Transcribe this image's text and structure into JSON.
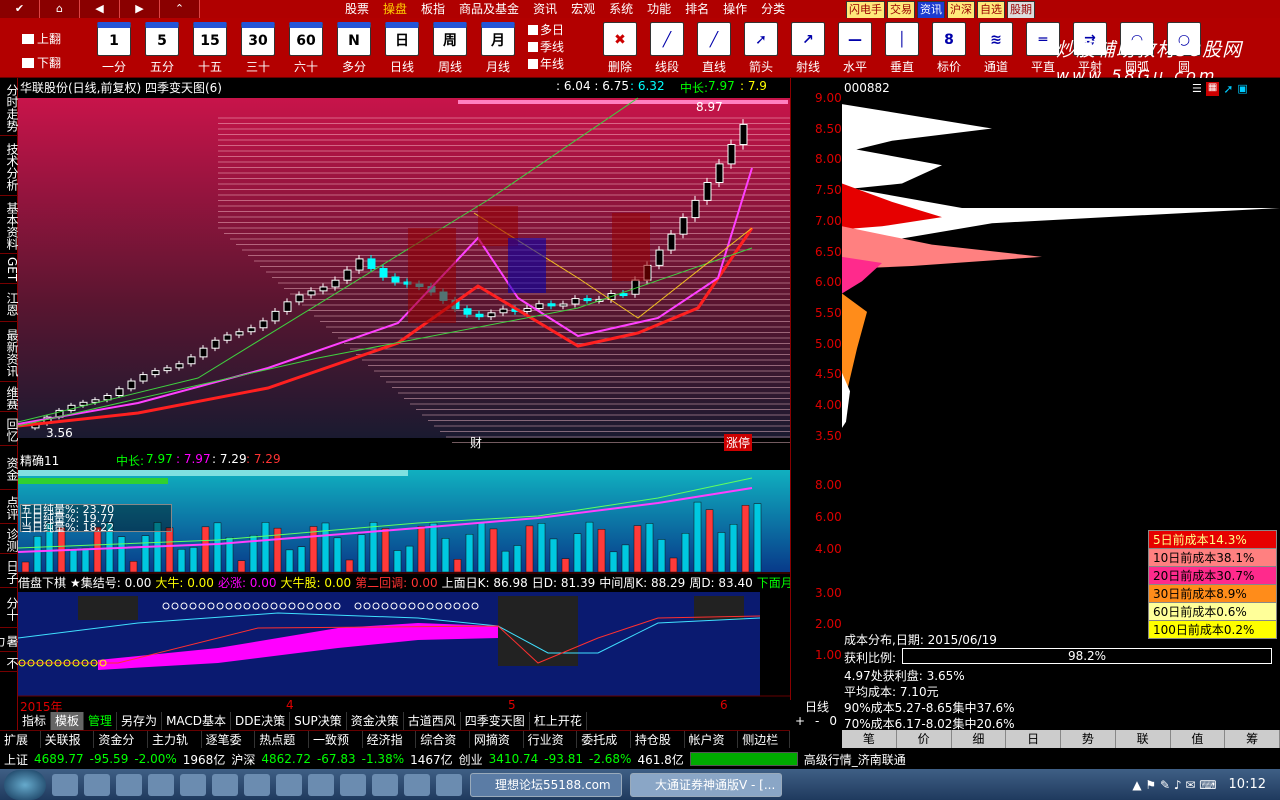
{
  "menubar": {
    "items": [
      "股票",
      "操盘",
      "板指",
      "商品及基金",
      "资讯",
      "宏观",
      "系统",
      "功能",
      "排名",
      "操作",
      "分类"
    ],
    "active_index": 1,
    "quick": [
      "闪电手",
      "交易",
      "资讯",
      "沪深",
      "自选",
      "股期"
    ]
  },
  "toolbar": {
    "up": "上翻",
    "down": "下翻",
    "periods": [
      {
        "icon": "1",
        "label": "一分"
      },
      {
        "icon": "5",
        "label": "五分"
      },
      {
        "icon": "15",
        "label": "十五"
      },
      {
        "icon": "30",
        "label": "三十"
      },
      {
        "icon": "60",
        "label": "六十"
      },
      {
        "icon": "N",
        "label": "多分"
      },
      {
        "icon": "日",
        "label": "日线"
      },
      {
        "icon": "周",
        "label": "周线"
      },
      {
        "icon": "月",
        "label": "月线"
      }
    ],
    "multi": [
      "多日",
      "季线",
      "年线"
    ],
    "tools": [
      "删除",
      "线段",
      "直线",
      "箭头",
      "射线",
      "水平",
      "垂直",
      "标价",
      "通道",
      "平直",
      "平射",
      "圆弧",
      "圆"
    ]
  },
  "watermark": {
    "line1": "炒股辅助教材58股网",
    "line2": "www.58Gu.com"
  },
  "lefttabs": [
    "分时走势",
    "技术分析",
    "基本资料",
    "GET",
    "江恩",
    "最新资讯",
    "维赛",
    "回忆",
    "资金",
    "点评",
    "诊测",
    "日子",
    "分十",
    "暑力",
    "不"
  ],
  "chart": {
    "title": "华联股份(日线,前复权) 四季变天图(6)",
    "range": ": 6.04 : 6.75",
    "val1": ": 6.32",
    "mid_label": "中长:",
    "mid_val": "7.97",
    "val2": ": 7.9",
    "price_axis": [
      "9.00",
      "8.50",
      "8.00",
      "7.50",
      "7.00",
      "6.50",
      "6.00",
      "5.50",
      "5.00",
      "4.50",
      "4.00",
      "3.50"
    ],
    "hi_label": "8.97",
    "lo_label": "3.56",
    "cai": "财",
    "zt": "涨停"
  },
  "ind1": {
    "name": "精确11",
    "mid_label": "中长:",
    "v1": "7.97",
    "v2": ": 7.97",
    "v3": ": 7.29",
    "v4": ": 7.29",
    "axis": [
      "8.00",
      "6.00",
      "4.00"
    ],
    "box": [
      "五日纯量%: 23.70",
      "十日纯量%: 19.77",
      "当日纯量%: 18.22"
    ]
  },
  "ind2": {
    "head": [
      "借盘下棋",
      "★集结号: 0.00",
      "大牛: 0.00",
      "必涨: 0.00",
      "大牛股: 0.00",
      "第二回调: 0.00",
      "上面日K: 86.98",
      "日D: 81.39",
      "中间周K: 88.29",
      "周D: 83.40",
      "下面月K"
    ],
    "axis": [
      "3.00",
      "2.00",
      "1.00"
    ]
  },
  "dateaxis": {
    "labels": [
      "2015年",
      "4",
      "5",
      "6"
    ],
    "right": "日线"
  },
  "info": {
    "code": "000882",
    "dist_date": "成本分布,日期: 2015/06/19",
    "profit_label": "获利比例:",
    "profit_val": "98.2%",
    "line1": "4.97处获利盘: 3.65%",
    "line2": "平均成本: 7.10元",
    "line3": "90%成本5.27-8.65集中37.6%",
    "line4": "70%成本6.17-8.02集中20.6%"
  },
  "fenbu": [
    "5日前成本14.3%",
    "10日前成本38.1%",
    "20日前成本30.7%",
    "30日前成本8.9%",
    "60日前成本0.6%",
    "100日前成本0.2%"
  ],
  "fenbu_colors": [
    "#e60000",
    "#ff8080",
    "#ff2a8c",
    "#ff8c1a",
    "#ffff99",
    "#ffff00"
  ],
  "tabs1": [
    "指标",
    "模板",
    "管理",
    "另存为",
    "MACD基本",
    "DDE决策",
    "SUP决策",
    "资金决策",
    "古道西风",
    "四季变天图",
    "杠上开花"
  ],
  "tabs1_right": [
    "+",
    "-",
    "0"
  ],
  "tabs2": [
    "扩展^",
    "关联报价",
    "资金分布",
    "主力轨迹",
    "逐笔委托",
    "热点题材",
    "一致预期",
    "经济指标",
    "综合资讯",
    "网摘资讯",
    "行业资讯",
    "委托成交",
    "持仓股份",
    "帐户资金",
    "侧边栏<"
  ],
  "tabs3": [
    "笔",
    "价",
    "细",
    "日",
    "势",
    "联",
    "值",
    "筹"
  ],
  "ticker": {
    "sh_name": "上证",
    "sh": "4689.77",
    "sh_chg": "-95.59",
    "sh_pct": "-2.00%",
    "sh_amt": "1968亿",
    "sz_name": "沪深",
    "sz": "4862.72",
    "sz_chg": "-67.83",
    "sz_pct": "-1.38%",
    "sz_amt": "1467亿",
    "cy_name": "创业",
    "cy": "3410.74",
    "cy_chg": "-93.81",
    "cy_pct": "-2.68%",
    "cy_amt": "461.8亿",
    "server": "高级行情_济南联通"
  },
  "taskbar": {
    "task1": "理想论坛55188.com",
    "task2": "大通证券神通版V - [...",
    "clock": "10:12"
  }
}
